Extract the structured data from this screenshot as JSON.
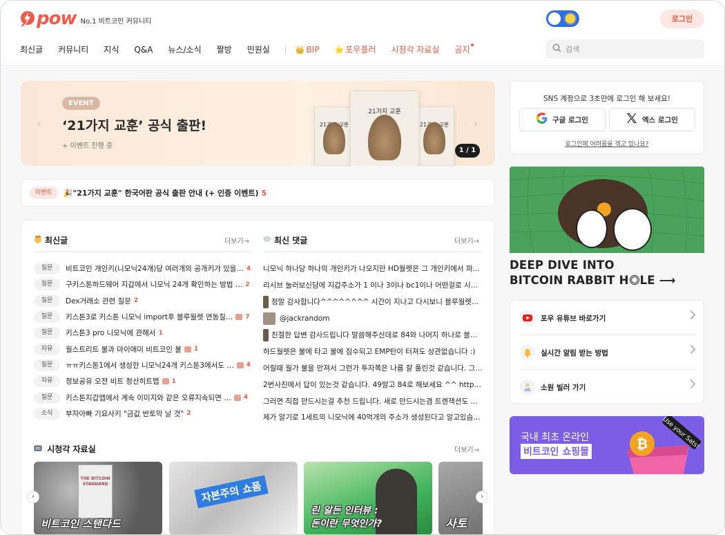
{
  "header": {
    "logo_text": "pow",
    "logo_tagline": "No.1 비트코인 커뮤니티",
    "login_label": "로그인",
    "search_placeholder": "검색",
    "nav": [
      {
        "label": "최신글"
      },
      {
        "label": "커뮤니티"
      },
      {
        "label": "지식"
      },
      {
        "label": "Q&A"
      },
      {
        "label": "뉴스/소식"
      },
      {
        "label": "짤방"
      },
      {
        "label": "민원실"
      },
      {
        "label": "BIP",
        "emoji": "👑"
      },
      {
        "label": "포우플러",
        "emoji": "⭐"
      },
      {
        "label": "시청각 자료실"
      },
      {
        "label": "공지"
      }
    ]
  },
  "banner": {
    "chip": "EVENT",
    "title": "‘21가지 교훈’ 공식 출판!",
    "subtitle": "+ 이벤트 진행 중",
    "book_title": "21가지 교훈",
    "counter": "1 / 1",
    "prev": "‹",
    "next": "›"
  },
  "notice": {
    "chip": "이벤트",
    "text": "🎉\"21가지 교훈\" 한국어판 공식 출판 안내 (+ 인증 이벤트)",
    "count": "5"
  },
  "latest": {
    "title": "최신글",
    "more": "더보기→",
    "posts": [
      {
        "tag": "질문",
        "title": "비트코인 개인키(니모닉24개)당 여러개의 공개키가 있을…",
        "img": false,
        "count": "4"
      },
      {
        "tag": "질문",
        "title": "구키스톤하드웨어 지갑에서 니모닉 24개 확인하는 방법 …",
        "img": false,
        "count": "2"
      },
      {
        "tag": "질문",
        "title": "Dex거래소 관련 질문",
        "img": false,
        "count": "2"
      },
      {
        "tag": "질문",
        "title": "키스톤3로 키스톤 니모닉 import후 블루월렛 연동질…",
        "img": true,
        "count": "7"
      },
      {
        "tag": "질문",
        "title": "키스톤3 pro 니모닉에 관해서",
        "img": false,
        "count": "1"
      },
      {
        "tag": "자유",
        "title": "월스트리트 불과 마이애미 비트코인 불",
        "img": true,
        "count": "1"
      },
      {
        "tag": "질문",
        "title": "ㅠㅠ키스톤1에서 생성한 니모닉24개 키스톤3에서도 …",
        "img": true,
        "count": "4"
      },
      {
        "tag": "자유",
        "title": "정보공유 오전 비트 청산히트맵",
        "img": true,
        "count": "1"
      },
      {
        "tag": "질문",
        "title": "키스톤지갑앱에서 계속 이미지와 같은 오류지속되면 …",
        "img": true,
        "count": "4"
      },
      {
        "tag": "소식",
        "title": "부자아빠 기요사키 \"금값 반토막 날 것\"",
        "img": false,
        "count": "2"
      }
    ]
  },
  "comments": {
    "title": "최신 댓글",
    "more": "더보기→",
    "items": [
      {
        "avatar": "",
        "text": "니모닉 하나당 하나의 개인키가 나오지만 HD월렛은 그 개인키에서 파…"
      },
      {
        "avatar": "",
        "text": "리시브 눌러보신담에 지갑주소가 1 이나 3이나 bc1이나 어떤걸로 시작…"
      },
      {
        "avatar": "bar",
        "text": "정말 감사합니다^^^^^^^^ 시간이 지나고 다시보니 블루월렛이 불…"
      },
      {
        "avatar": "square",
        "text": "@jackrandom"
      },
      {
        "avatar": "bar",
        "text": "친절한 답변 감사드립니다 말씀해주신데로 84와 나머지 하나로 블…"
      },
      {
        "avatar": "",
        "text": "하드월렛은 불에 타고 물에 침수되고 EMP탄이 터져도 상관없습니다 :)"
      },
      {
        "avatar": "",
        "text": "어릴때 월가 불을 만져서 그런가 투자쪽은 나름 잘 풀린것 같습니다. 그…"
      },
      {
        "avatar": "",
        "text": "2번사진에서 답이 있는것 같습니다. 49말고 84로 해보세요 ^^ https:…"
      },
      {
        "avatar": "",
        "text": "그러면 직접 만드시는걸 추천 드립니다. 새로 만드시는겸 트렌잭션도 …"
      },
      {
        "avatar": "",
        "text": "제가 알기로 1세트의 니모닉에 40억개의 주소가 생성된다고 알고있슴…"
      }
    ]
  },
  "videos": {
    "title": "시청각 자료실",
    "more": "더보기→",
    "items": [
      {
        "title": "비트코인 스탠다드",
        "bg": "#6d6d6d",
        "book": "THE BITCOIN STANDARD"
      },
      {
        "title": "자본주의 쇼폼",
        "bg": "#e9e9e9"
      },
      {
        "title": "린 알든 인터뷰 :\n돈이란 무엇인가?",
        "bg": "#5ec26a"
      },
      {
        "title": "사토",
        "bg": "#8a8a8a"
      }
    ],
    "prev": "‹",
    "next": "›"
  },
  "sidebar": {
    "login_lead": "SNS 계정으로 3초만에 로그인 해 보세요!",
    "google_label": "구글 로그인",
    "x_label": "엑스 로그인",
    "help_link": "로그인에 어려움을 겪고 있나요?",
    "ad_line1": "DEEP DIVE INTO",
    "ad_line2": "BITCOIN RABBIT H",
    "ad_line3": "LE ⟶",
    "links": [
      {
        "label": "포우 유튜브 바로가기",
        "icon": "youtube-icon"
      },
      {
        "label": "실시간 알림 받는 방법",
        "icon": "bell-icon"
      },
      {
        "label": "소원 빌러 가기",
        "icon": "pray-icon"
      }
    ],
    "shop_line1": "국내 최초 온라인",
    "shop_line2": "비트코인 쇼핑몰",
    "shop_tag": "Use your Sats!"
  },
  "colors": {
    "accent": "#ef5a44",
    "toggle": "#2f6fe0",
    "shop": "#7c5de6",
    "ad": "#4aa35b"
  }
}
